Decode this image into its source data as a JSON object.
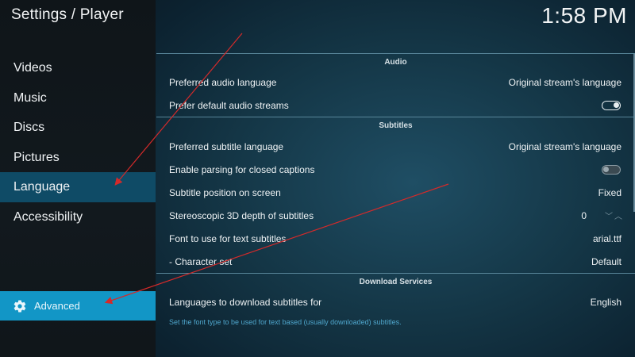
{
  "header": {
    "title": "Settings / Player",
    "clock": "1:58 PM"
  },
  "sidebar": {
    "items": [
      {
        "label": "Videos"
      },
      {
        "label": "Music"
      },
      {
        "label": "Discs"
      },
      {
        "label": "Pictures"
      },
      {
        "label": "Language",
        "active": true
      },
      {
        "label": "Accessibility"
      }
    ],
    "advanced_label": "Advanced"
  },
  "sections": {
    "audio": {
      "title": "Audio",
      "preferred_audio_language": {
        "label": "Preferred audio language",
        "value": "Original stream's language"
      },
      "prefer_default_audio_streams": {
        "label": "Prefer default audio streams",
        "value": true
      }
    },
    "subtitles": {
      "title": "Subtitles",
      "preferred_subtitle_language": {
        "label": "Preferred subtitle language",
        "value": "Original stream's language"
      },
      "enable_closed_captions": {
        "label": "Enable parsing for closed captions",
        "value": false
      },
      "subtitle_position": {
        "label": "Subtitle position on screen",
        "value": "Fixed"
      },
      "stereoscopic_depth": {
        "label": "Stereoscopic 3D depth of subtitles",
        "value": "0"
      },
      "font": {
        "label": "Font to use for text subtitles",
        "value": "arial.ttf"
      },
      "character_set": {
        "label": "- Character set",
        "value": "Default"
      }
    },
    "download": {
      "title": "Download Services",
      "languages": {
        "label": "Languages to download subtitles for",
        "value": "English"
      }
    }
  },
  "description": "Set the font type to be used for text based (usually downloaded) subtitles.",
  "colors": {
    "accent": "#1296c6",
    "active_item": "#0f4b66",
    "annotation_arrow": "#d42a2a",
    "description_text": "#4fa6cc"
  }
}
